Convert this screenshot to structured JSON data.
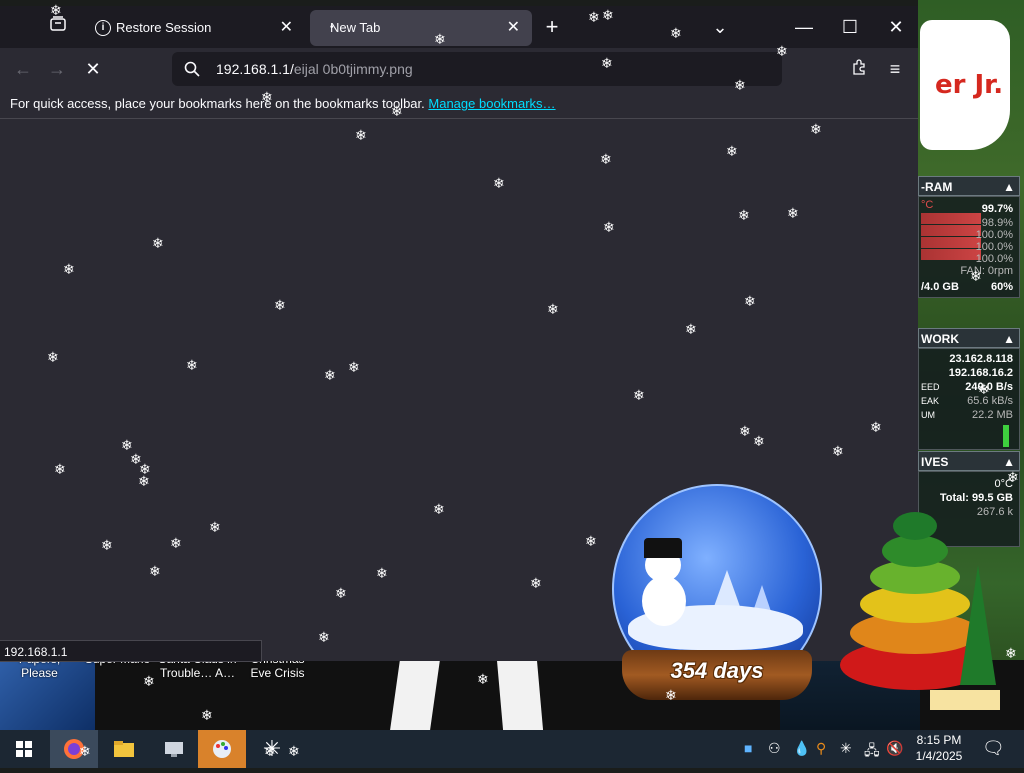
{
  "browser": {
    "tabs": [
      {
        "label": "Restore Session"
      },
      {
        "label": "New Tab"
      }
    ],
    "url": {
      "host": "192.168.1.1/",
      "path": "eijal  0b0tjimmy.png"
    },
    "bookmarks_bar": {
      "message": "For quick access, place your bookmarks here on the bookmarks toolbar.",
      "link": "Manage bookmarks…"
    },
    "status_text": "192.168.1.1"
  },
  "desktop": {
    "icons": [
      {
        "label": "Papers, Please"
      },
      {
        "label": "Super Mario"
      },
      {
        "label": "Santa Claus in Trouble… A…"
      },
      {
        "label": "Christmas Eve Crisis"
      }
    ],
    "cloud_text": "er Jr.",
    "snow_globe_label": "354 days"
  },
  "sysmon": {
    "ram": {
      "title": "-RAM",
      "unit": "°C",
      "values": [
        "99.7%",
        "98.9%",
        "100.0%",
        "100.0%",
        "100.0%"
      ],
      "fan": "FAN: 0rpm",
      "total": "/4.0 GB",
      "usage": "60%"
    },
    "network": {
      "title": "WORK",
      "ip1": "23.162.8.118",
      "ip2": "192.168.16.2",
      "speed_label": "EED",
      "speed": "240.0 B/s",
      "peak_label": "EAK",
      "peak": "65.6 kB/s",
      "sum_label": "UM",
      "sum": "22.2 MB"
    },
    "drives": {
      "title": "IVES",
      "temp": "0°C",
      "total": "Total: 99.5 GB",
      "speed": "267.6 k"
    }
  },
  "taskbar": {
    "clock": {
      "time": "8:15 PM",
      "date": "1/4/2025"
    }
  },
  "colors": {
    "browser_bg": "#2b2a33",
    "tabbar_bg": "#1c1b22",
    "link": "#00ddff",
    "taskbar_bg": "#1c2733"
  }
}
